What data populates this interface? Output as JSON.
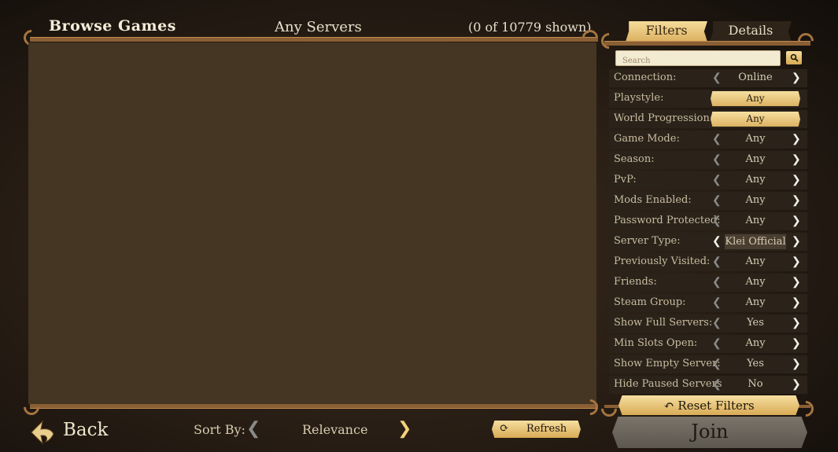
{
  "header": {
    "title": "Browse Games",
    "server_scope": "Any Servers",
    "count": "(0 of 10779 shown)"
  },
  "tabs": [
    {
      "label": "Filters",
      "active": true
    },
    {
      "label": "Details",
      "active": false
    }
  ],
  "search": {
    "placeholder": "Search",
    "value": ""
  },
  "filters": [
    {
      "label": "Connection:",
      "value": "Online",
      "style": "arrows"
    },
    {
      "label": "Playstyle:",
      "value": "Any",
      "style": "pill"
    },
    {
      "label": "World Progression:",
      "value": "Any",
      "style": "pill"
    },
    {
      "label": "Game Mode:",
      "value": "Any",
      "style": "arrows"
    },
    {
      "label": "Season:",
      "value": "Any",
      "style": "arrows"
    },
    {
      "label": "PvP:",
      "value": "Any",
      "style": "arrows"
    },
    {
      "label": "Mods Enabled:",
      "value": "Any",
      "style": "arrows"
    },
    {
      "label": "Password Protected:",
      "value": "Any",
      "style": "arrows"
    },
    {
      "label": "Server Type:",
      "value": "Klei Official",
      "style": "arrows-highlight"
    },
    {
      "label": "Previously Visited:",
      "value": "Any",
      "style": "arrows"
    },
    {
      "label": "Friends:",
      "value": "Any",
      "style": "arrows"
    },
    {
      "label": "Steam Group:",
      "value": "Any",
      "style": "arrows"
    },
    {
      "label": "Show Full Servers:",
      "value": "Yes",
      "style": "arrows"
    },
    {
      "label": "Min Slots Open:",
      "value": "Any",
      "style": "arrows"
    },
    {
      "label": "Show Empty Server:",
      "value": "Yes",
      "style": "arrows"
    },
    {
      "label": "Hide Paused Servers",
      "value": "No",
      "style": "arrows"
    }
  ],
  "buttons": {
    "reset_filters": "Reset Filters",
    "join": "Join",
    "back": "Back",
    "refresh": "Refresh"
  },
  "sort": {
    "label": "Sort By:",
    "value": "Relevance"
  },
  "icons": {
    "search": "magnifier-icon",
    "reset": "undo-arrow-icon",
    "refresh": "refresh-icon",
    "back": "back-arrow-icon"
  },
  "colors": {
    "accent_gold": "#f4dc9a",
    "panel_brown": "#453624",
    "row_dark": "#2b231a",
    "join_gray": "#6e685f"
  }
}
